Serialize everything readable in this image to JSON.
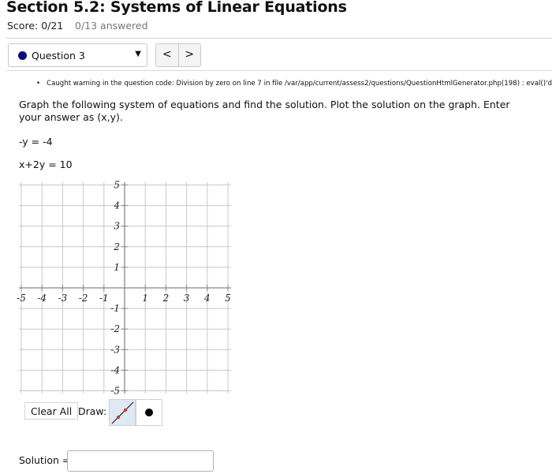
{
  "header": {
    "title": "Section 5.2: Systems of Linear Equations",
    "score": "Score: 0/21",
    "answered": "0/13 answered"
  },
  "question_nav": {
    "selected": "Question 3",
    "status_color": "#0b0b7a",
    "caret": "▼",
    "prev": "<",
    "next": ">"
  },
  "warning": {
    "bullet": "•",
    "text": "Caught warning in the question code: Division by zero on line 7 in file /var/app/current/assess2/questions/QuestionHtmlGenerator.php(198) : eval()'d code"
  },
  "question": {
    "prompt": "Graph the following system of equations and find the solution. Plot the solution on the graph. Enter your answer as (x,y).",
    "equations": [
      "-y = -4",
      "x+2y = 10"
    ]
  },
  "graph": {
    "x_range": [
      -5,
      5
    ],
    "y_range": [
      -5,
      5
    ],
    "x_ticks": [
      -5,
      -4,
      -3,
      -2,
      -1,
      1,
      2,
      3,
      4,
      5
    ],
    "y_ticks": [
      5,
      4,
      3,
      2,
      1,
      -1,
      -2,
      -3,
      -4,
      -5
    ],
    "gridline_color": "#c8c8c8",
    "axis_color": "#888888"
  },
  "tools": {
    "clear_all": "Clear All",
    "draw_label": "Draw:",
    "items": [
      {
        "name": "line-tool",
        "selected": true
      },
      {
        "name": "point-tool",
        "selected": false
      }
    ]
  },
  "answer": {
    "label": "Solution =",
    "value": "",
    "placeholder": ""
  }
}
